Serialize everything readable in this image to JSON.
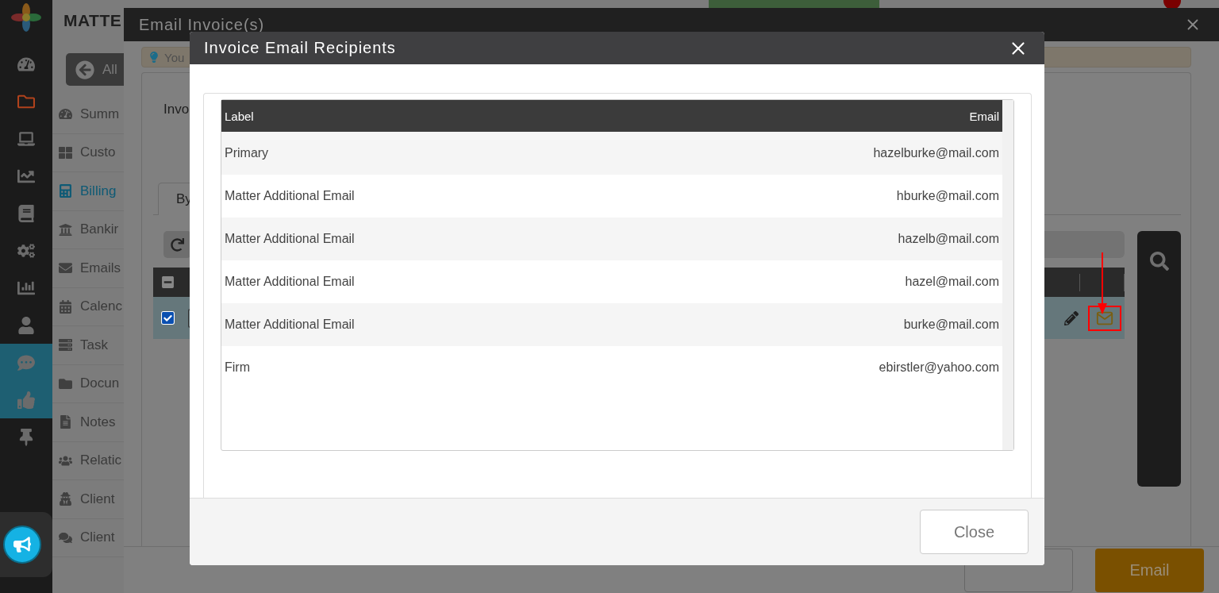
{
  "app": {
    "title": "MATTE"
  },
  "rail": [
    {
      "selected": false,
      "highlighted": false
    },
    {
      "selected": true,
      "highlighted": false
    },
    {
      "selected": false,
      "highlighted": false
    },
    {
      "selected": false,
      "highlighted": false
    },
    {
      "selected": false,
      "highlighted": false
    },
    {
      "selected": false,
      "highlighted": false
    },
    {
      "selected": false,
      "highlighted": false
    },
    {
      "selected": false,
      "highlighted": false
    },
    {
      "selected": false,
      "highlighted": true
    },
    {
      "selected": false,
      "highlighted": true
    },
    {
      "selected": false,
      "highlighted": false
    }
  ],
  "nav": {
    "back_label": "All",
    "items": [
      {
        "label": "Summ",
        "selected": false
      },
      {
        "label": "Custo",
        "selected": false
      },
      {
        "label": "Billing",
        "selected": true
      },
      {
        "label": "Bankir",
        "selected": false
      },
      {
        "label": "Emails",
        "selected": false
      },
      {
        "label": "Calenc",
        "selected": false
      },
      {
        "label": "Task",
        "selected": false
      },
      {
        "label": "Docun",
        "selected": false
      },
      {
        "label": "Notes",
        "selected": false
      },
      {
        "label": "Relatic",
        "selected": false
      },
      {
        "label": "Client",
        "selected": false
      },
      {
        "label": "Client",
        "selected": false
      }
    ]
  },
  "email_dialog": {
    "title": "Email Invoice(s)",
    "tip": "You",
    "invoice_label": "Invo",
    "tab": {
      "label": "By",
      "selected": true
    },
    "header_indeterminate": true,
    "row": {
      "checked": true
    },
    "email_button": "Email"
  },
  "recipients_dialog": {
    "title": "Invoice Email Recipients",
    "columns": [
      "Label",
      "Email"
    ],
    "rows": [
      {
        "label": "Primary",
        "email": "hazelburke@mail.com"
      },
      {
        "label": "Matter Additional Email",
        "email": "hburke@mail.com"
      },
      {
        "label": "Matter Additional Email",
        "email": "hazelb@mail.com"
      },
      {
        "label": "Matter Additional Email",
        "email": "hazel@mail.com"
      },
      {
        "label": "Matter Additional Email",
        "email": "burke@mail.com"
      },
      {
        "label": "Firm",
        "email": "ebirstler@yahoo.com"
      }
    ],
    "close_button": "Close"
  }
}
